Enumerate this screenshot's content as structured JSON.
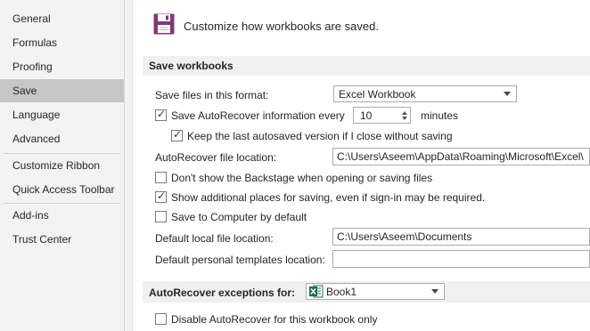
{
  "sidebar": {
    "items": [
      {
        "label": "General"
      },
      {
        "label": "Formulas"
      },
      {
        "label": "Proofing"
      },
      {
        "label": "Save"
      },
      {
        "label": "Language"
      },
      {
        "label": "Advanced"
      },
      {
        "label": "Customize Ribbon"
      },
      {
        "label": "Quick Access Toolbar"
      },
      {
        "label": "Add-ins"
      },
      {
        "label": "Trust Center"
      }
    ],
    "selected": "Save"
  },
  "header": {
    "icon": "floppy-disk-icon",
    "icon_color": "#7e3878",
    "title": "Customize how workbooks are saved."
  },
  "save_workbooks": {
    "section_title": "Save workbooks",
    "format_label": "Save files in this format:",
    "format_value": "Excel Workbook",
    "autorecover_checked": true,
    "autorecover_label": "Save AutoRecover information every",
    "autorecover_minutes": "10",
    "minutes_label": "minutes",
    "keep_last_checked": true,
    "keep_last_label": "Keep the last autosaved version if I close without saving",
    "autorecover_location_label": "AutoRecover file location:",
    "autorecover_location_value": "C:\\Users\\Aseem\\AppData\\Roaming\\Microsoft\\Excel\\",
    "no_backstage_checked": false,
    "no_backstage_label": "Don't show the Backstage when opening or saving files",
    "additional_places_checked": true,
    "additional_places_label": "Show additional places for saving, even if sign-in may be required.",
    "save_to_computer_checked": false,
    "save_to_computer_label": "Save to Computer by default",
    "default_local_label": "Default local file location:",
    "default_local_value": "C:\\Users\\Aseem\\Documents",
    "personal_templates_label": "Default personal templates location:",
    "personal_templates_value": ""
  },
  "exceptions": {
    "section_title": "AutoRecover exceptions for:",
    "workbook_value": "Book1",
    "workbook_icon": "excel-icon",
    "excel_color": "#1e7145",
    "disable_checked": false,
    "disable_label": "Disable AutoRecover for this workbook only"
  }
}
